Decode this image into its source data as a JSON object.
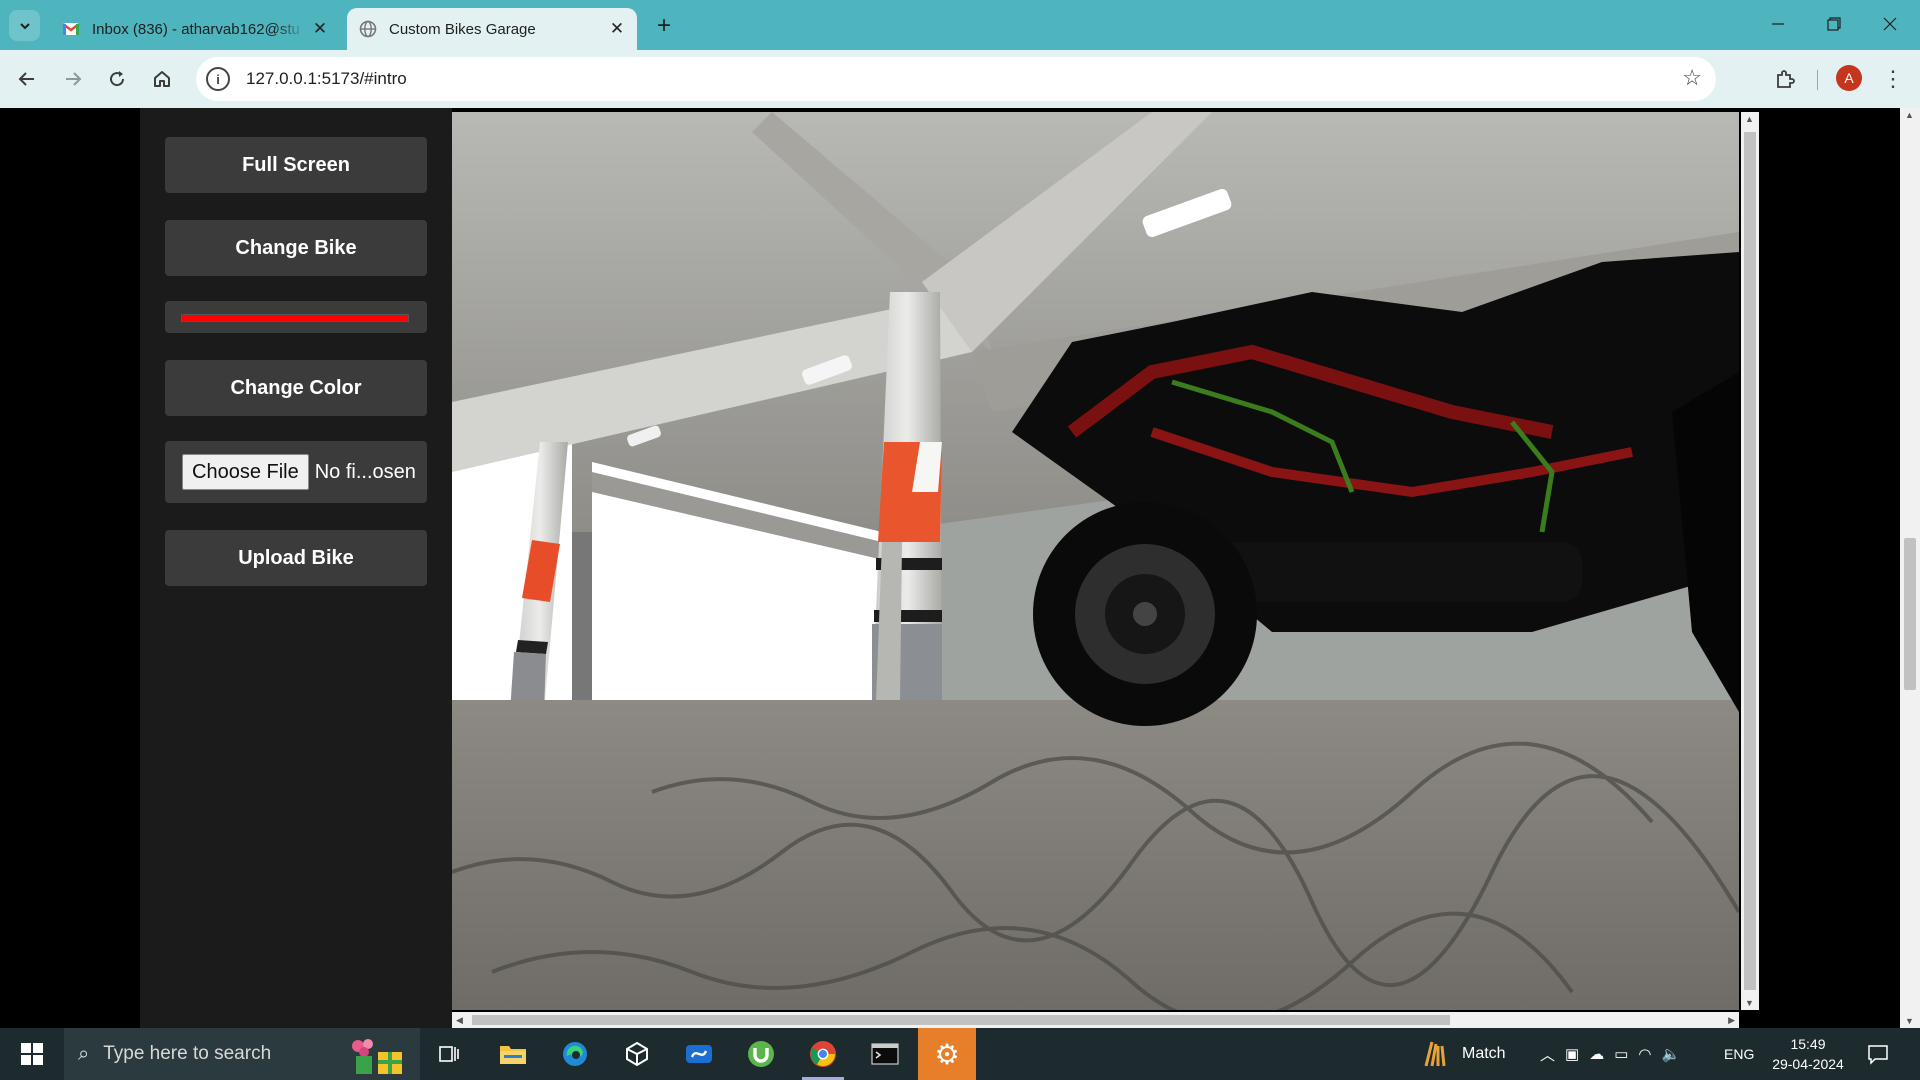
{
  "browser": {
    "tabs": [
      {
        "title": "Inbox (836) - atharvab162@stu",
        "icon": "gmail-icon",
        "active": false
      },
      {
        "title": "Custom Bikes Garage",
        "icon": "globe-icon",
        "active": true
      }
    ],
    "url": "127.0.0.1:5173/#intro",
    "profile_initial": "A"
  },
  "sidebar": {
    "full_screen_label": "Full Screen",
    "change_bike_label": "Change Bike",
    "color_value": "#ff0000",
    "change_color_label": "Change Color",
    "choose_file_label": "Choose File",
    "file_status": "No fi...osen",
    "upload_bike_label": "Upload Bike"
  },
  "taskbar": {
    "search_placeholder": "Type here to search",
    "weather_text": "Match",
    "language": "ENG",
    "time": "15:49",
    "date": "29-04-2024"
  }
}
